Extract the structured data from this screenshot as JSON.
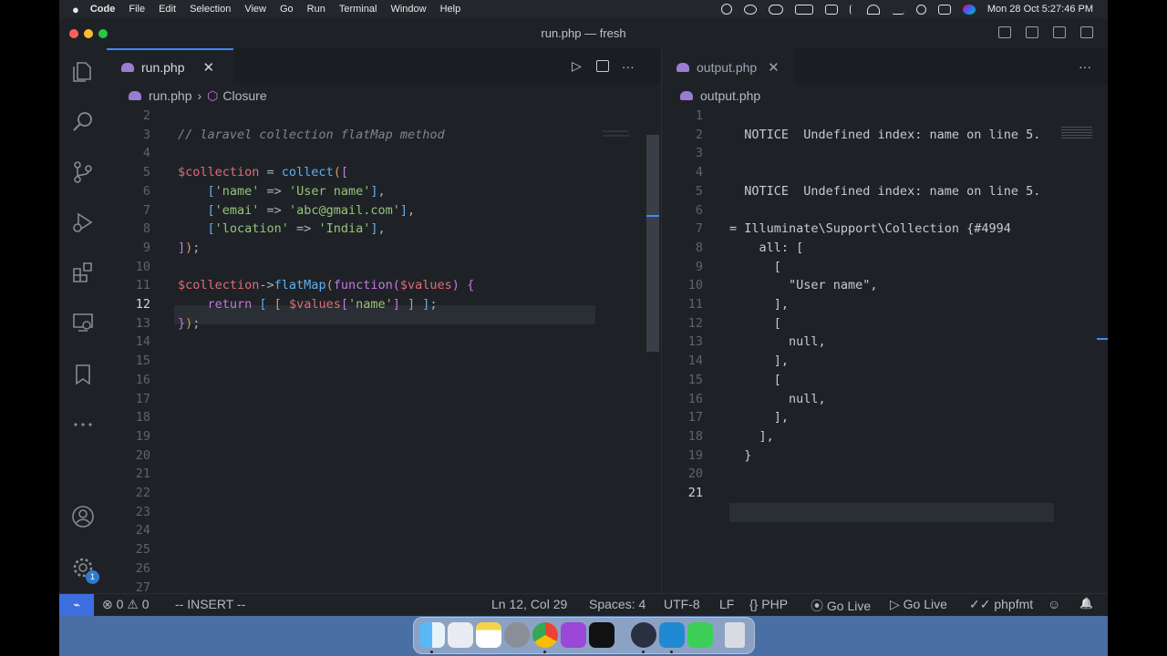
{
  "menubar": {
    "apple": "",
    "app": "Code",
    "items": [
      "File",
      "Edit",
      "Selection",
      "View",
      "Go",
      "Run",
      "Terminal",
      "Window",
      "Help"
    ],
    "clock": "Mon 28 Oct  5:27:46 PM"
  },
  "window": {
    "title": "run.php — fresh"
  },
  "left_editor": {
    "tab_label": "run.php",
    "tab_close": "✕",
    "more": "···",
    "breadcrumb": {
      "file": "run.php",
      "sep": "›",
      "symbol": "Closure"
    },
    "current_line": 12,
    "lines": [
      {
        "n": "2",
        "parts": []
      },
      {
        "n": "3",
        "parts": [
          {
            "t": "// laravel collection flatMap method",
            "c": "t-com"
          }
        ]
      },
      {
        "n": "4",
        "parts": []
      },
      {
        "n": "5",
        "parts": [
          {
            "t": "$collection",
            "c": "t-var"
          },
          {
            "t": " = ",
            "c": "t-p"
          },
          {
            "t": "collect",
            "c": "t-fn"
          },
          {
            "t": "(",
            "c": "t-br"
          },
          {
            "t": "[",
            "c": "t-br2"
          }
        ]
      },
      {
        "n": "6",
        "parts": [
          {
            "t": "    [",
            "c": "t-br3"
          },
          {
            "t": "'name'",
            "c": "t-str"
          },
          {
            "t": " => ",
            "c": "t-p"
          },
          {
            "t": "'User name'",
            "c": "t-str"
          },
          {
            "t": "]",
            "c": "t-br3"
          },
          {
            "t": ",",
            "c": "t-p"
          }
        ]
      },
      {
        "n": "7",
        "parts": [
          {
            "t": "    [",
            "c": "t-br3"
          },
          {
            "t": "'emai'",
            "c": "t-str"
          },
          {
            "t": " => ",
            "c": "t-p"
          },
          {
            "t": "'abc@gmail.com'",
            "c": "t-str"
          },
          {
            "t": "]",
            "c": "t-br3"
          },
          {
            "t": ",",
            "c": "t-p"
          }
        ]
      },
      {
        "n": "8",
        "parts": [
          {
            "t": "    [",
            "c": "t-br3"
          },
          {
            "t": "'location'",
            "c": "t-str"
          },
          {
            "t": " => ",
            "c": "t-p"
          },
          {
            "t": "'India'",
            "c": "t-str"
          },
          {
            "t": "]",
            "c": "t-br3"
          },
          {
            "t": ",",
            "c": "t-p"
          }
        ]
      },
      {
        "n": "9",
        "parts": [
          {
            "t": "]",
            "c": "t-br2"
          },
          {
            "t": ")",
            "c": "t-br"
          },
          {
            "t": ";",
            "c": "t-p"
          }
        ]
      },
      {
        "n": "10",
        "parts": []
      },
      {
        "n": "11",
        "parts": [
          {
            "t": "$collection",
            "c": "t-var"
          },
          {
            "t": "->",
            "c": "t-p"
          },
          {
            "t": "flatMap",
            "c": "t-fn"
          },
          {
            "t": "(",
            "c": "t-br"
          },
          {
            "t": "function",
            "c": "t-kw"
          },
          {
            "t": "(",
            "c": "t-br2"
          },
          {
            "t": "$values",
            "c": "t-var"
          },
          {
            "t": ")",
            "c": "t-br2"
          },
          {
            "t": " {",
            "c": "t-br2"
          }
        ]
      },
      {
        "n": "12",
        "parts": [
          {
            "t": "    return ",
            "c": "t-kw"
          },
          {
            "t": "[ ",
            "c": "t-br3"
          },
          {
            "t": "[ ",
            "c": "t-br"
          },
          {
            "t": "$values",
            "c": "t-var"
          },
          {
            "t": "[",
            "c": "t-br2"
          },
          {
            "t": "'name'",
            "c": "t-str"
          },
          {
            "t": "]",
            "c": "t-br2"
          },
          {
            "t": " ]",
            "c": "t-br"
          },
          {
            "t": " ]",
            "c": "t-br3"
          },
          {
            "t": ";",
            "c": "t-p"
          }
        ]
      },
      {
        "n": "13",
        "parts": [
          {
            "t": "}",
            "c": "t-br2"
          },
          {
            "t": ")",
            "c": "t-br"
          },
          {
            "t": ";",
            "c": "t-p"
          }
        ]
      },
      {
        "n": "14",
        "parts": []
      },
      {
        "n": "15",
        "parts": []
      },
      {
        "n": "16",
        "parts": []
      },
      {
        "n": "17",
        "parts": []
      },
      {
        "n": "18",
        "parts": []
      },
      {
        "n": "19",
        "parts": []
      },
      {
        "n": "20",
        "parts": []
      },
      {
        "n": "21",
        "parts": []
      },
      {
        "n": "22",
        "parts": []
      },
      {
        "n": "23",
        "parts": []
      },
      {
        "n": "24",
        "parts": []
      },
      {
        "n": "25",
        "parts": []
      },
      {
        "n": "26",
        "parts": []
      },
      {
        "n": "27",
        "parts": []
      }
    ]
  },
  "right_editor": {
    "tab_label": "output.php",
    "tab_close": "✕",
    "more": "···",
    "breadcrumb": {
      "file": "output.php"
    },
    "current_line": 21,
    "lines": [
      {
        "n": "1",
        "text": ""
      },
      {
        "n": "2",
        "text": "  NOTICE  Undefined index: name on line 5."
      },
      {
        "n": "3",
        "text": ""
      },
      {
        "n": "4",
        "text": ""
      },
      {
        "n": "5",
        "text": "  NOTICE  Undefined index: name on line 5."
      },
      {
        "n": "6",
        "text": ""
      },
      {
        "n": "7",
        "text": "= Illuminate\\Support\\Collection {#4994"
      },
      {
        "n": "8",
        "text": "    all: ["
      },
      {
        "n": "9",
        "text": "      ["
      },
      {
        "n": "10",
        "text": "        \"User name\","
      },
      {
        "n": "11",
        "text": "      ],"
      },
      {
        "n": "12",
        "text": "      ["
      },
      {
        "n": "13",
        "text": "        null,"
      },
      {
        "n": "14",
        "text": "      ],"
      },
      {
        "n": "15",
        "text": "      ["
      },
      {
        "n": "16",
        "text": "        null,"
      },
      {
        "n": "17",
        "text": "      ],"
      },
      {
        "n": "18",
        "text": "    ],"
      },
      {
        "n": "19",
        "text": "  }"
      },
      {
        "n": "20",
        "text": ""
      },
      {
        "n": "21",
        "text": ""
      }
    ]
  },
  "activity": [
    "explorer-icon",
    "search-icon",
    "source-control-icon",
    "run-debug-icon",
    "extensions-icon",
    "remote-explorer-icon",
    "bookmark-icon",
    "more-icon",
    "account-icon",
    "manage-gear-icon"
  ],
  "activity_badge": "1",
  "statusbar": {
    "remote": "⌁",
    "problems": "⊗ 0 ⚠ 0",
    "mode": "-- INSERT --",
    "position": "Ln 12, Col 29",
    "spaces": "Spaces: 4",
    "encoding": "UTF-8",
    "eol": "LF",
    "language": "{} PHP",
    "golive1": "⦿ Go Live",
    "golive2": "▷ Go Live",
    "formatter": "✓✓ phpfmt",
    "feedback": "☺",
    "bell": "🔔"
  },
  "colors": {
    "accent": "#3d8bfd",
    "remote": "#3d6ee0",
    "bg": "#1e2227"
  },
  "dock": [
    "finder",
    "launchpad",
    "notes",
    "system-settings",
    "chrome",
    "podcasts",
    "apple-tv",
    "quicktime",
    "vscode",
    "facetime",
    "trash"
  ]
}
